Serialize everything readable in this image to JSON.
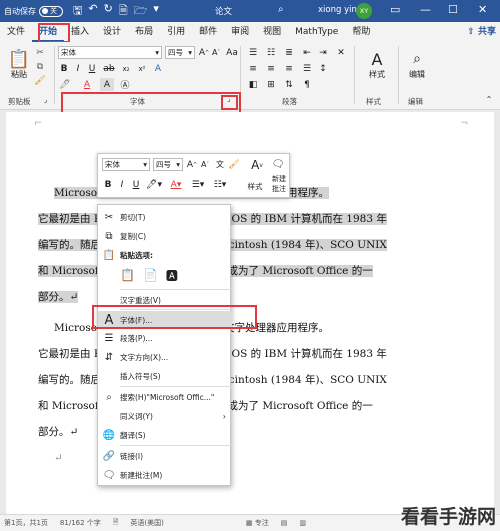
{
  "titlebar": {
    "autosave": "自动保存",
    "toggle": "关",
    "doc_title": "论文",
    "user": "xiong yin",
    "avatar": "XY"
  },
  "tabs": [
    "文件",
    "开始",
    "插入",
    "设计",
    "布局",
    "引用",
    "邮件",
    "审阅",
    "视图",
    "MathType",
    "帮助"
  ],
  "share": "共享",
  "ribbon": {
    "paste": "粘贴",
    "font_name": "宋体",
    "font_size": "四号",
    "style": "样式",
    "edit": "编辑",
    "groups": {
      "clipboard": "剪贴板",
      "font": "字体",
      "paragraph": "段落",
      "styles": "样式",
      "editing": "编辑"
    }
  },
  "document": {
    "para1_lines": [
      "Microsoft Word 是微软公司的一个文字处理器应用程序。",
      "它最初是由 Richard Brodie 为了运行 DOS 的 IBM 计算机而在 1983 年",
      "编写的。随后的版本可运行于 Apple Macintosh (1984 年)、SCO UNIX",
      "和 Microsoft Windows (1989 年)，并成为了 Microsoft Office 的一",
      "部分。↵"
    ],
    "para2_lines": [
      "Microsoft Word 是微软公司的一个文字处理器应用程序。",
      "它最初是由 Richard Brodie 为了运行 DOS 的 IBM 计算机而在 1983 年",
      "编写的。随后的版本可运行于 Apple Macintosh (1984 年)、SCO UNIX",
      "和 Microsoft Windows (1989 年)，并成为了 Microsoft Office 的一",
      "部分。↵"
    ],
    "empty_mark": "↵"
  },
  "mini_toolbar": {
    "font": "宋体",
    "size": "四号",
    "style": "样式",
    "new_comment": "新建\n批注"
  },
  "context_menu": {
    "cut": "剪切(T)",
    "copy": "复制(C)",
    "paste_options": "粘贴选项:",
    "hanzi": "汉字重选(V)",
    "font": "字体(F)...",
    "paragraph": "段落(P)...",
    "text_direction": "文字方向(X)...",
    "insert_symbol": "插入符号(S)",
    "search": "搜索(H)\"Microsoft Offic...\"",
    "synonyms": "同义词(Y)",
    "translate": "翻译(S)",
    "link": "链接(I)",
    "new_comment": "新建批注(M)"
  },
  "statusbar": {
    "page": "第1页，共1页",
    "words": "81/162 个字",
    "lang": "英语(美国)",
    "focus": "专注"
  },
  "watermark": "看看手游网",
  "colors": {
    "accent": "#2b579a",
    "highlight": "#e0393e"
  }
}
